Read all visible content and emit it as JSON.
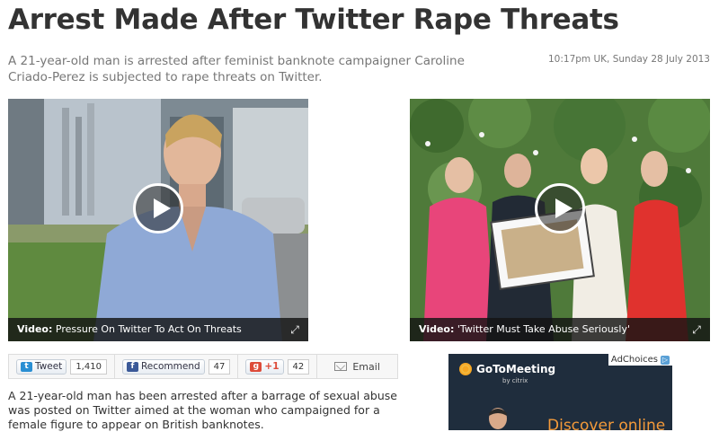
{
  "headline": "Arrest Made After Twitter Rape Threats",
  "standfirst": "A 21-year-old man is arrested after feminist banknote campaigner Caroline Criado-Perez is subjected to rape threats on Twitter.",
  "timestamp": "10:17pm UK, Sunday 28 July 2013",
  "videos": [
    {
      "label": "Video:",
      "caption": "Pressure On Twitter To Act On Threats"
    },
    {
      "label": "Video:",
      "caption": "'Twitter Must Take Abuse Seriously'"
    }
  ],
  "share": {
    "tweet_label": "Tweet",
    "tweet_count": "1,410",
    "recommend_label": "Recommend",
    "recommend_count": "47",
    "gplus_label": "+1",
    "gplus_count": "42",
    "email_label": "Email"
  },
  "body": "A 21-year-old man has been arrested after a barrage of sexual abuse was posted on Twitter aimed at the woman who campaigned for a female figure to appear on British banknotes.",
  "ad": {
    "choices_label": "AdChoices",
    "brand": "GoToMeeting",
    "brand_sub": "by citrix",
    "tagline": "Discover online"
  },
  "colors": {
    "twitter_blue": "#2a8fd3",
    "facebook_blue": "#3b5998",
    "gplus_red": "#dd4b39",
    "ad_orange": "#f39a3a"
  }
}
